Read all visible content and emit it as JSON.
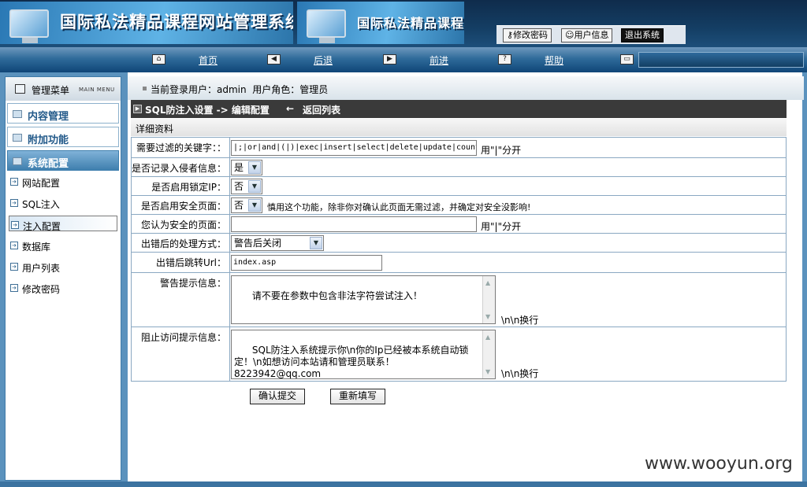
{
  "header": {
    "title1": "国际私法精品课程网站管理系统",
    "title2": "国际私法精品课程",
    "toolbar": {
      "change_pwd": "修改密码",
      "user_info": "用户信息",
      "logout": "退出系统"
    }
  },
  "nav": {
    "home": "首页",
    "back": "后退",
    "forward": "前进",
    "help": "帮助",
    "help_icon": "?"
  },
  "sidebar": {
    "title": "管理菜单",
    "title_en": "MAIN MENU",
    "categories": [
      {
        "label": "内容管理"
      },
      {
        "label": "附加功能"
      },
      {
        "label": "系统配置"
      }
    ],
    "items": [
      {
        "label": "网站配置"
      },
      {
        "label": "SQL注入"
      },
      {
        "label": "注入配置"
      },
      {
        "label": "数据库"
      },
      {
        "label": "用户列表"
      },
      {
        "label": "修改密码"
      }
    ]
  },
  "userbar": {
    "text": "当前登录用户：admin  用户角色：管理员"
  },
  "breadcrumb": {
    "part1": "SQL防注入设置 -> 编辑配置",
    "arrow": "←",
    "part2": "返回列表"
  },
  "section": {
    "title": "详细资料"
  },
  "form": {
    "keywords": {
      "label": "需要过滤的关键字：：",
      "value": "|;|or|and|(|)|exec|insert|select|delete|update|count",
      "hint": "用\"|\"分开"
    },
    "record_intruder": {
      "label": "是否记录入侵者信息：",
      "value": "是"
    },
    "lock_ip": {
      "label": "是否启用锁定IP：",
      "value": "否"
    },
    "safe_page": {
      "label": "是否启用安全页面：",
      "value": "否",
      "hint": "慎用这个功能，除非你对确认此页面无需过滤，并确定对安全没影响!"
    },
    "safe_pages": {
      "label": "您认为安全的页面：",
      "value": "",
      "hint": "用\"|\"分开"
    },
    "error_mode": {
      "label": "出错后的处理方式：",
      "value": "警告后关闭"
    },
    "redirect": {
      "label": "出错后跳转Url：",
      "value": "index.asp"
    },
    "warn_msg": {
      "label": "警告提示信息：",
      "value": "请不要在参数中包含非法字符尝试注入！",
      "hint": "\\n\\n换行"
    },
    "block_msg": {
      "label": "阻止访问提示信息：",
      "value": "SQL防注入系统提示你\\n你的Ip已经被本系统自动锁定！\\n如想访问本站请和管理员联系！\n8223942@qq.com",
      "hint": "\\n\\n换行"
    }
  },
  "buttons": {
    "submit": "确认提交",
    "reset": "重新填写"
  },
  "watermark": "www.wooyun.org"
}
